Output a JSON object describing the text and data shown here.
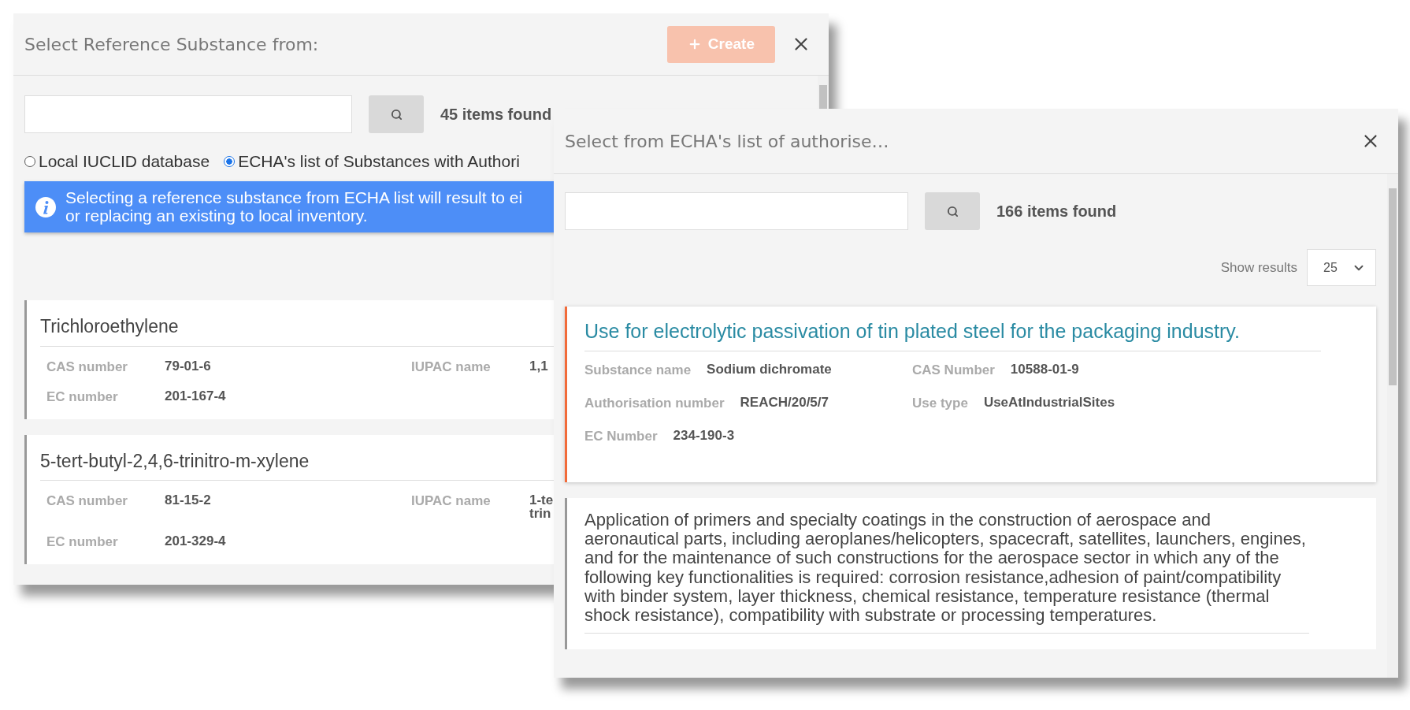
{
  "reference_dialog": {
    "title": "Select Reference Substance from:",
    "create_button": {
      "label": "Create",
      "disabled": true
    },
    "results_count": "45 items found",
    "sources": [
      {
        "label": "Local IUCLID database",
        "selected": false
      },
      {
        "label": "ECHA's list of Substances with Authori",
        "selected": true
      }
    ],
    "info_message": "Selecting a reference substance from ECHA list will result to ei\nor replacing an existing to local inventory.",
    "substances": [
      {
        "name": "Trichloroethylene",
        "fields": [
          {
            "label": "CAS number",
            "value": "79-01-6"
          },
          {
            "label": "IUPAC name",
            "value": "1,1"
          },
          {
            "label": "EC number",
            "value": "201-167-4"
          }
        ]
      },
      {
        "name": "5-tert-butyl-2,4,6-trinitro-m-xylene",
        "fields": [
          {
            "label": "CAS number",
            "value": "81-15-2"
          },
          {
            "label": "IUPAC name",
            "value": "1-te\ntrin"
          },
          {
            "label": "EC number",
            "value": "201-329-4"
          }
        ]
      }
    ]
  },
  "echa_dialog": {
    "title": "Select from ECHA's list of authorise…",
    "results_count": "166 items found",
    "show_results": {
      "label": "Show results",
      "value": "25"
    },
    "uses": [
      {
        "title": "Use for electrolytic passivation of tin plated steel for the packaging industry.",
        "selected": true,
        "fields": [
          {
            "label": "Substance name",
            "value": "Sodium dichromate"
          },
          {
            "label": "CAS Number",
            "value": "10588-01-9"
          },
          {
            "label": "Authorisation number",
            "value": "REACH/20/5/7"
          },
          {
            "label": "Use type",
            "value": "UseAtIndustrialSites"
          },
          {
            "label": "EC Number",
            "value": "234-190-3"
          }
        ]
      },
      {
        "title": "Application of primers and specialty coatings in the construction of aerospace and aeronautical parts, including aeroplanes/helicopters, spacecraft, satellites, launchers, engines, and for the maintenance of such constructions for the aerospace sector in which any of the following key functionalities is required: corrosion resistance,adhesion of paint/compatibility with binder system, layer thickness, chemical resistance, temperature resistance (thermal shock resistance), compatibility with substrate or processing temperatures.",
        "selected": false
      }
    ]
  }
}
